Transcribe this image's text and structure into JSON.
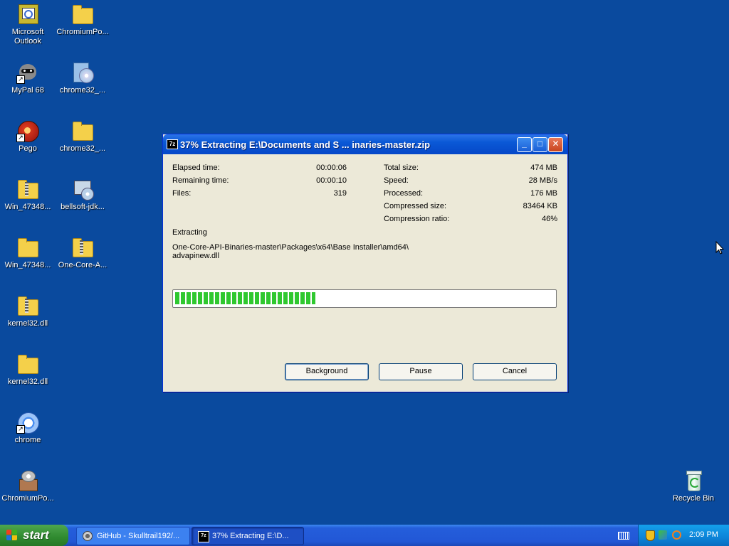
{
  "desktop": {
    "icons": [
      {
        "label": "Microsoft Outlook"
      },
      {
        "label": "ChromiumPo..."
      },
      {
        "label": "MyPal 68"
      },
      {
        "label": "chrome32_..."
      },
      {
        "label": "Pego"
      },
      {
        "label": "chrome32_..."
      },
      {
        "label": "Win_47348..."
      },
      {
        "label": "bellsoft-jdk..."
      },
      {
        "label": "Win_47348..."
      },
      {
        "label": "One-Core-A..."
      },
      {
        "label": "kernel32.dll"
      },
      {
        "label": "kernel32.dll"
      },
      {
        "label": "chrome"
      },
      {
        "label": "ChromiumPo..."
      },
      {
        "label": "Recycle Bin"
      }
    ]
  },
  "dialog": {
    "app_icon": "7z",
    "title": "37% Extracting E:\\Documents and S ... inaries-master.zip",
    "controls": {
      "minimize": "_",
      "maximize": "□",
      "close": "✕"
    },
    "left_stats": [
      {
        "label": "Elapsed time:",
        "value": "00:00:06"
      },
      {
        "label": "Remaining time:",
        "value": "00:00:10"
      },
      {
        "label": "Files:",
        "value": "319"
      }
    ],
    "right_stats": [
      {
        "label": "Total size:",
        "value": "474 MB"
      },
      {
        "label": "Speed:",
        "value": "28 MB/s"
      },
      {
        "label": "Processed:",
        "value": "176 MB"
      },
      {
        "label": "Compressed size:",
        "value": "83464 KB"
      },
      {
        "label": "Compression ratio:",
        "value": "46%"
      }
    ],
    "operation": "Extracting",
    "current_path_line1": "One-Core-API-Binaries-master\\Packages\\x64\\Base Installer\\amd64\\",
    "current_path_line2": "advapinew.dll",
    "progress_fraction": 0.37,
    "buttons": {
      "background": "Background",
      "pause": "Pause",
      "cancel": "Cancel"
    }
  },
  "taskbar": {
    "start_label": "start",
    "tasks": [
      {
        "label": "GitHub - Skulltrail192/..."
      },
      {
        "label": "37% Extracting E:\\D..."
      }
    ],
    "clock": "2:09 PM"
  },
  "colors": {
    "desktop": "#0a4a9e",
    "title_bar": "#0548c8",
    "progress_fill": "#2fc82f",
    "taskbar": "#2257d6",
    "start_button": "#2f8a2f"
  }
}
